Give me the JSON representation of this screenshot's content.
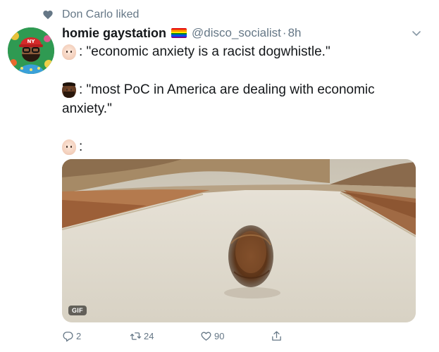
{
  "social_context": {
    "text": "Don Carlo liked",
    "icon": "heart-icon"
  },
  "tweet": {
    "author": {
      "name": "homie gaystation",
      "handle": "@disco_socialist",
      "flag": "rainbow-flag"
    },
    "separator": "·",
    "time": "8h",
    "lines": [
      {
        "emoji": "person-light-skin",
        "text": ": \"economic anxiety is a racist dogwhistle.\""
      },
      {
        "emoji": "person-dark-skin-beard",
        "text": ": \"most PoC in America are dealing with economic"
      },
      {
        "text": "anxiety.\""
      },
      {
        "emoji": "person-light-skin",
        "text": ":"
      }
    ],
    "media": {
      "badge": "GIF"
    },
    "actions": {
      "reply": {
        "count": "2"
      },
      "retweet": {
        "count": "24"
      },
      "like": {
        "count": "90"
      },
      "share": {
        "count": ""
      }
    }
  },
  "colors": {
    "secondary_text": "#657786",
    "primary_text": "#14171a",
    "background": "#ffffff"
  }
}
